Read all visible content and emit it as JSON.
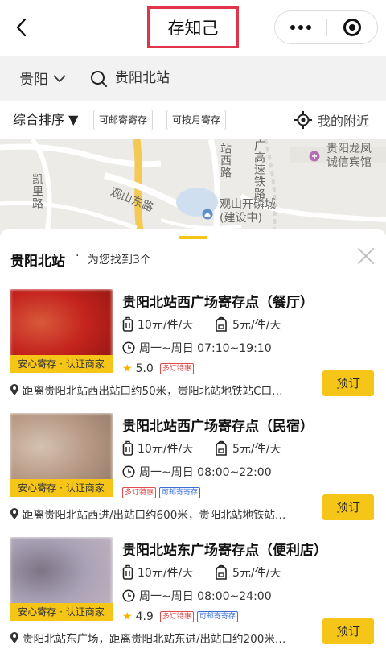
{
  "nav": {
    "title": "存知己"
  },
  "search": {
    "city": "贵阳",
    "query": "贵阳北站"
  },
  "filters": {
    "sort_label": "综合排序 ▼",
    "chips": [
      "可邮寄寄存",
      "可按月寄存"
    ],
    "nearby_label": "我的附近"
  },
  "map": {
    "labels": {
      "station_west_road": "站西路",
      "highspeed_rail": "广高速铁路",
      "hotel": "贵阳龙凤\n诚信宾馆",
      "guanshan_east_road": "观山东路",
      "kaili_road": "凯里路",
      "poi": "观山开磷城\n(建设中)"
    }
  },
  "panel": {
    "title": "贵阳北站",
    "separator": "·",
    "count_text": "为您找到3个"
  },
  "results": [
    {
      "name": "贵阳北站西广场寄存点（餐厅）",
      "cert": "安心寄存 · 认证商家",
      "large_price": "10元/件/天",
      "small_price": "5元/件/天",
      "hours": "周一~周日 07:10~19:10",
      "rating": "5.0",
      "tags": [
        {
          "text": "多订特惠",
          "color": "red"
        }
      ],
      "distance": "距离贵阳北站西出站口约50米，贵阳北站地铁站C口…",
      "book": "预订",
      "thumb_colors": [
        "#c4231d",
        "#8a1410",
        "#d85a3a"
      ]
    },
    {
      "name": "贵阳北站西广场寄存点（民宿）",
      "cert": "安心寄存 · 认证商家",
      "large_price": "10元/件/天",
      "small_price": "5元/件/天",
      "hours": "周一~周日 08:00~22:00",
      "rating": "",
      "tags": [
        {
          "text": "多订特惠",
          "color": "red"
        },
        {
          "text": "可邮寄寄存",
          "color": "blue"
        }
      ],
      "distance": "距离贵阳北站西进/出站口约600米，贵阳北站地铁站…",
      "book": "预订",
      "thumb_colors": [
        "#b89a86",
        "#8d7360",
        "#d5c2b2"
      ]
    },
    {
      "name": "贵阳北站东广场寄存点（便利店）",
      "cert": "安心寄存 · 认证商家",
      "large_price": "10元/件/天",
      "small_price": "5元/件/天",
      "hours": "周一~周日 08:00~24:00",
      "rating": "4.9",
      "tags": [
        {
          "text": "多订特惠",
          "color": "red"
        },
        {
          "text": "可邮寄寄存",
          "color": "blue"
        }
      ],
      "distance": "贵阳北站东广场，距离贵阳北站东进/出站口约200米…",
      "book": "预订",
      "thumb_colors": [
        "#a9a2b6",
        "#c7b7c2",
        "#7d7485"
      ]
    }
  ]
}
